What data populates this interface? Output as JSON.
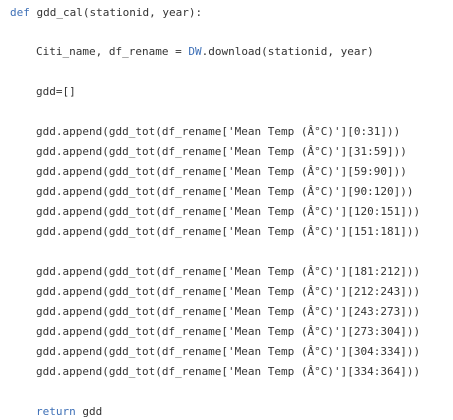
{
  "code": {
    "def_keyword": "def",
    "signature": " gdd_cal(stationid, year):",
    "line_assign_prefix": "Citi_name, df_rename = ",
    "line_assign_ref": "DW",
    "line_assign_suffix": ".download(stationid, year)",
    "line_init": "gdd=[]",
    "group1": [
      "gdd.append(gdd_tot(df_rename['Mean Temp (Â°C)'][0:31]))",
      "gdd.append(gdd_tot(df_rename['Mean Temp (Â°C)'][31:59]))",
      "gdd.append(gdd_tot(df_rename['Mean Temp (Â°C)'][59:90]))",
      "gdd.append(gdd_tot(df_rename['Mean Temp (Â°C)'][90:120]))",
      "gdd.append(gdd_tot(df_rename['Mean Temp (Â°C)'][120:151]))",
      "gdd.append(gdd_tot(df_rename['Mean Temp (Â°C)'][151:181]))"
    ],
    "group2": [
      "gdd.append(gdd_tot(df_rename['Mean Temp (Â°C)'][181:212]))",
      "gdd.append(gdd_tot(df_rename['Mean Temp (Â°C)'][212:243]))",
      "gdd.append(gdd_tot(df_rename['Mean Temp (Â°C)'][243:273]))",
      "gdd.append(gdd_tot(df_rename['Mean Temp (Â°C)'][273:304]))",
      "gdd.append(gdd_tot(df_rename['Mean Temp (Â°C)'][304:334]))",
      "gdd.append(gdd_tot(df_rename['Mean Temp (Â°C)'][334:364]))"
    ],
    "return_keyword": "return",
    "return_value": " gdd"
  },
  "colors": {
    "keyword": "#3d6fb6",
    "text": "#333333",
    "background": "#ffffff"
  }
}
